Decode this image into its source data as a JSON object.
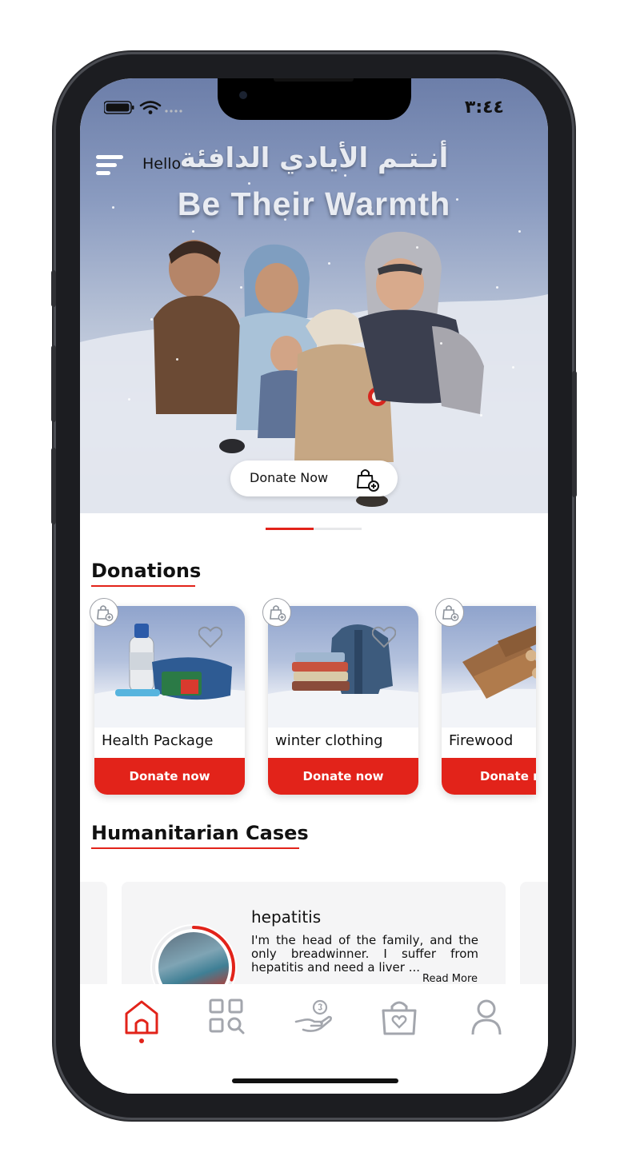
{
  "status_bar": {
    "time": "٣:٤٤"
  },
  "header": {
    "greeting": "Hello"
  },
  "hero": {
    "title_ar": "أنـتـم الأيادي الدافئة",
    "title_en": "Be Their Warmth",
    "donate_label": "Donate Now",
    "carousel_active": 1,
    "carousel_total": 2
  },
  "donations": {
    "title": "Donations",
    "items": [
      {
        "name": "Health Package",
        "button": "Donate now",
        "image_icon": "health-package-image"
      },
      {
        "name": "winter clothing",
        "button": "Donate now",
        "image_icon": "winter-clothing-image"
      },
      {
        "name": "Firewood",
        "button": "Donate now",
        "image_icon": "firewood-image"
      }
    ]
  },
  "cases": {
    "title": "Humanitarian Cases",
    "items": [
      {
        "title": "hepatitis",
        "description": "I'm the head of the family, and the only breadwinner. I suffer from hepatitis and need a liver ...",
        "read_more": "Read More",
        "progress_percent": 30
      }
    ]
  },
  "tabbar": {
    "items": [
      {
        "icon": "home-icon",
        "active": true
      },
      {
        "icon": "categories-search-icon",
        "active": false
      },
      {
        "icon": "donate-hand-icon",
        "active": false
      },
      {
        "icon": "donation-bag-icon",
        "active": false
      },
      {
        "icon": "profile-icon",
        "active": false
      }
    ]
  },
  "colors": {
    "accent": "#e2231a",
    "text": "#111111",
    "inactive_icon": "#a3a6ad"
  }
}
